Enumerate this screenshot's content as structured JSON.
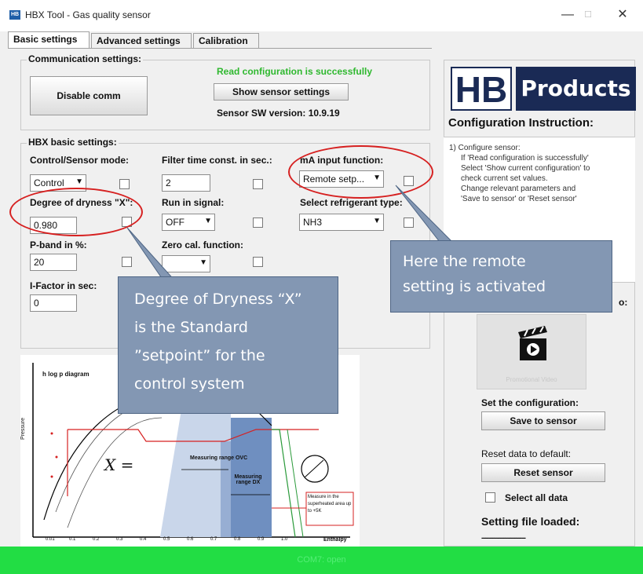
{
  "window": {
    "title": "HBX Tool - Gas quality sensor",
    "icon_text": "HB",
    "minimize": "—",
    "maximize": "☐",
    "close": "✕"
  },
  "tabs": [
    "Basic settings",
    "Advanced settings",
    "Calibration"
  ],
  "comm": {
    "group_label": "Communication settings:",
    "disable_button": "Disable comm",
    "status": "Read configuration is successfully",
    "show_button": "Show sensor settings",
    "sw_version": "Sensor SW version: 10.9.19"
  },
  "basic": {
    "group_label": "HBX basic settings:",
    "control_mode_label": "Control/Sensor mode:",
    "control_mode_value": "Control",
    "filter_label": "Filter time const. in sec.:",
    "filter_value": "2",
    "ma_label": "mA input function:",
    "ma_value": "Remote setp...",
    "dryness_label": "Degree of dryness \"X\":",
    "dryness_value": "0.980",
    "run_in_label": "Run in signal:",
    "run_in_value": "OFF",
    "refrigerant_label": "Select refrigerant type:",
    "refrigerant_value": "NH3",
    "pband_label": "P-band in %:",
    "pband_value": "20",
    "zero_cal_label": "Zero cal. function:",
    "ifactor_label": "I-Factor in sec:",
    "ifactor_value": "0"
  },
  "diagram": {
    "title": "h log p diagram",
    "y_label": "Pressure",
    "x_label": "Enthalpy",
    "formula": "X =",
    "range_ovc": "Measuring range OVC",
    "range_dx": "Measuring range DX",
    "superheated_note": "Measure in the superheated area up to +5K",
    "x_ticks": [
      "0.01",
      "0.1",
      "0.2",
      "0.3",
      "0.4",
      "0.5",
      "0.6",
      "0.7",
      "0.8",
      "0.9",
      "1.0"
    ]
  },
  "right": {
    "logo_hb": "HB",
    "logo_products": "Products",
    "instruction_title": "Configuration Instruction:",
    "instructions": [
      "1) Configure sensor:",
      "If 'Read configuration is successfully'",
      "Select 'Show current configuration' to",
      "check current set values.",
      "Change relevant parameters and",
      "'Save to sensor' or 'Reset sensor'"
    ],
    "video_label_fragment": "o:",
    "video_caption": "Promotional Video",
    "set_label": "Set the configuration:",
    "save_button": "Save to sensor",
    "reset_label": "Reset data to default:",
    "reset_button": "Reset sensor",
    "select_all": "Select all data",
    "setting_file": "Setting file loaded:",
    "setting_file_value": "------------------------"
  },
  "callouts": {
    "dryness_note": [
      "Degree of Dryness “X”",
      "is the Standard",
      "”setpoint” for the",
      "control system"
    ],
    "remote_note": [
      "Here the remote",
      "setting is activated"
    ]
  },
  "status": {
    "text": "COM7: open"
  },
  "colors": {
    "status_bar": "#22dd44",
    "callout": "#8397b3",
    "highlight": "#d62020",
    "logo_navy": "#1a2a55"
  }
}
